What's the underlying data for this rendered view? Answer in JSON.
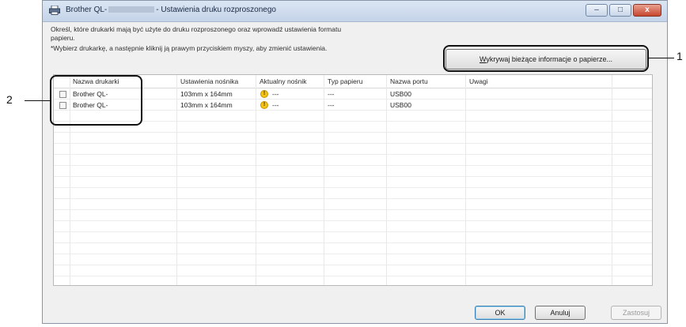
{
  "window": {
    "title_prefix": "Brother QL-",
    "title_suffix": "- Ustawienia druku rozproszonego",
    "minimize_glyph": "–",
    "maximize_glyph": "□",
    "close_glyph": "x"
  },
  "description": {
    "line1": "Określ, które drukarki mają być użyte do druku rozproszonego oraz wprowadź ustawienia formatu",
    "line2": "papieru.",
    "line3": "*Wybierz drukarkę, a następnie kliknij ją prawym przyciskiem myszy, aby zmienić ustawienia."
  },
  "detect_button": {
    "mnemonic": "W",
    "rest": "ykrywaj bieżące informacje o papierze..."
  },
  "table": {
    "columns": [
      "Nazwa drukarki",
      "Ustawienia nośnika",
      "Aktualny nośnik",
      "Typ papieru",
      "Nazwa portu",
      "Uwagi"
    ],
    "rows": [
      {
        "name": "Brother QL-",
        "media_setting": "103mm x 164mm",
        "current_media": "---",
        "paper_type": "---",
        "port": "USB00",
        "notes": "",
        "checked": false
      },
      {
        "name": "Brother QL-",
        "media_setting": "103mm x 164mm",
        "current_media": "---",
        "paper_type": "---",
        "port": "USB00",
        "notes": "",
        "checked": false
      }
    ]
  },
  "buttons": {
    "ok": "OK",
    "cancel": "Anuluj",
    "apply": "Zastosuj"
  },
  "callouts": {
    "label_1": "1",
    "label_2": "2"
  },
  "icons": {
    "warning": "warning-icon",
    "printer": "printer-icon"
  }
}
